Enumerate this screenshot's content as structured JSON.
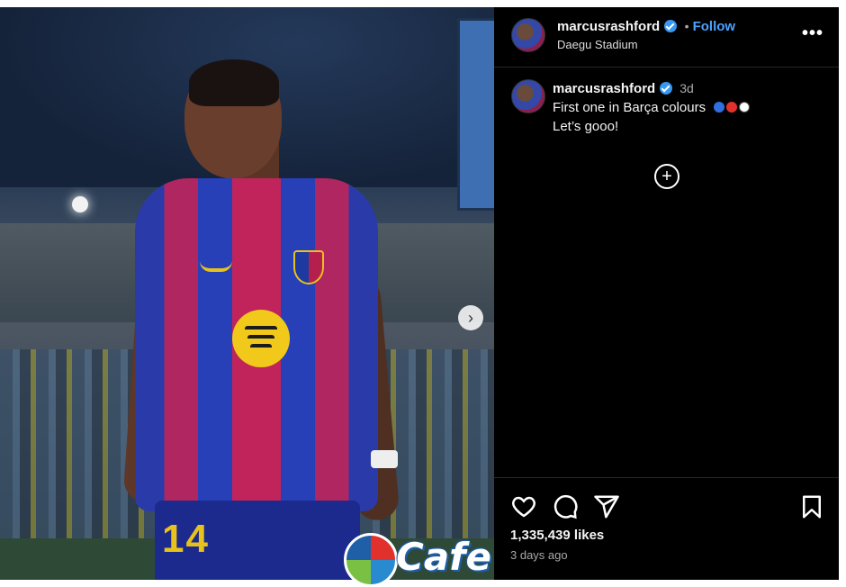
{
  "post": {
    "header": {
      "username": "marcusrashford",
      "separator": "•",
      "follow_label": "Follow",
      "location": "Daegu Stadium",
      "more_label": "•••"
    },
    "caption": {
      "username": "marcusrashford",
      "time": "3d",
      "line1": "First one in Barça colours",
      "line2": "Let’s gooo!",
      "emojis": [
        "blue-circle",
        "red-circle",
        "football"
      ]
    },
    "photo": {
      "jersey_number": "14",
      "next_label": "›"
    },
    "load_more_label": "+",
    "actions": {
      "icons": [
        "heart-icon",
        "comment-icon",
        "share-icon",
        "bookmark-icon"
      ]
    },
    "likes": "1,335,439 likes",
    "posted": "3 days ago",
    "colors": {
      "follow": "#4aa3ff",
      "verified": "#3897f0",
      "background": "#000000"
    }
  },
  "watermark": {
    "text": "Cafe"
  }
}
